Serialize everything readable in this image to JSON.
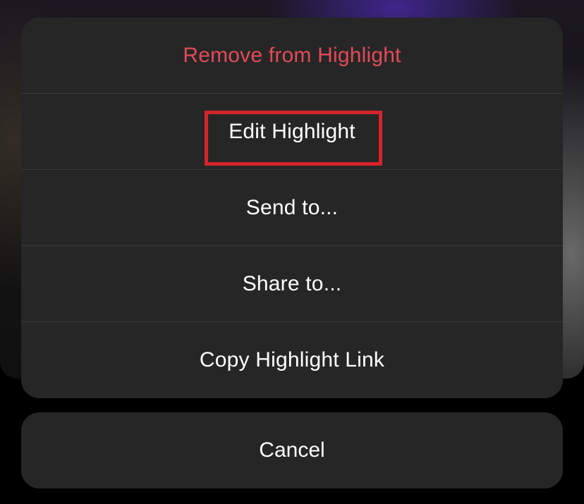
{
  "action_sheet": {
    "items": [
      {
        "label": "Remove from Highlight",
        "style": "destructive",
        "color": "#e34a58"
      },
      {
        "label": "Edit Highlight",
        "style": "default",
        "highlighted": true
      },
      {
        "label": "Send to...",
        "style": "default"
      },
      {
        "label": "Share to...",
        "style": "default"
      },
      {
        "label": "Copy Highlight Link",
        "style": "default"
      }
    ]
  },
  "cancel": {
    "label": "Cancel"
  },
  "colors": {
    "sheet_background": "#262626",
    "separator": "#3a3a3a",
    "destructive_text": "#e34a58",
    "annotation_box": "#d5242c",
    "text": "#ffffff"
  }
}
